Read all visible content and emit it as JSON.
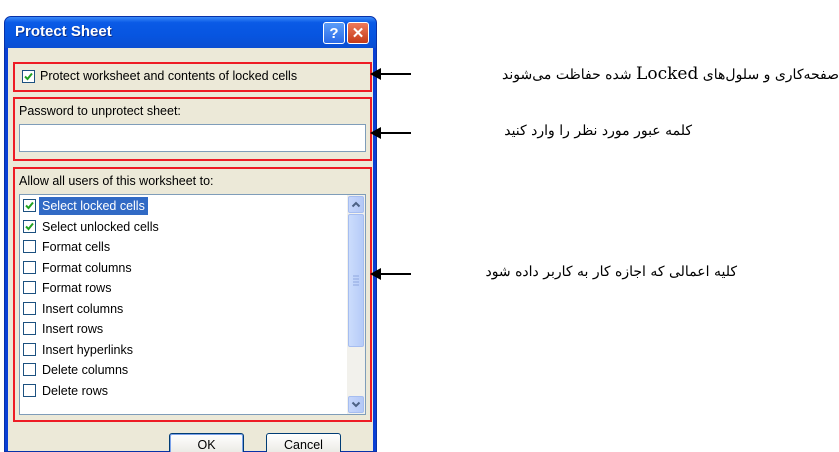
{
  "dialog": {
    "title": "Protect Sheet",
    "help_label": "?",
    "close_label": "✕",
    "protect_checkbox": {
      "label": "Protect worksheet and contents of locked cells",
      "checked": true
    },
    "password": {
      "label": "Password to unprotect sheet:",
      "value": ""
    },
    "allow_label": "Allow all users of this worksheet to:",
    "permissions": [
      {
        "label": "Select locked cells",
        "checked": true,
        "selected": true
      },
      {
        "label": "Select unlocked cells",
        "checked": true,
        "selected": false
      },
      {
        "label": "Format cells",
        "checked": false,
        "selected": false
      },
      {
        "label": "Format columns",
        "checked": false,
        "selected": false
      },
      {
        "label": "Format rows",
        "checked": false,
        "selected": false
      },
      {
        "label": "Insert columns",
        "checked": false,
        "selected": false
      },
      {
        "label": "Insert rows",
        "checked": false,
        "selected": false
      },
      {
        "label": "Insert hyperlinks",
        "checked": false,
        "selected": false
      },
      {
        "label": "Delete columns",
        "checked": false,
        "selected": false
      },
      {
        "label": "Delete rows",
        "checked": false,
        "selected": false
      }
    ],
    "ok_label": "OK",
    "cancel_label": "Cancel"
  },
  "annotations": {
    "protect_note_pre": "صفحه‌کاری و سلول‌های",
    "protect_note_latin": "Locked",
    "protect_note_post": "شده حفاظت می‌شوند",
    "password_note": "کلمه عبور مورد نظر را وارد کنید",
    "permissions_note": "کلیه اعمالی که اجازه کار به کاربر داده شود"
  },
  "colors": {
    "highlight": "#ee1c25",
    "titlebar": "#0755e0",
    "selection": "#316ac5",
    "check": "#21a121"
  }
}
